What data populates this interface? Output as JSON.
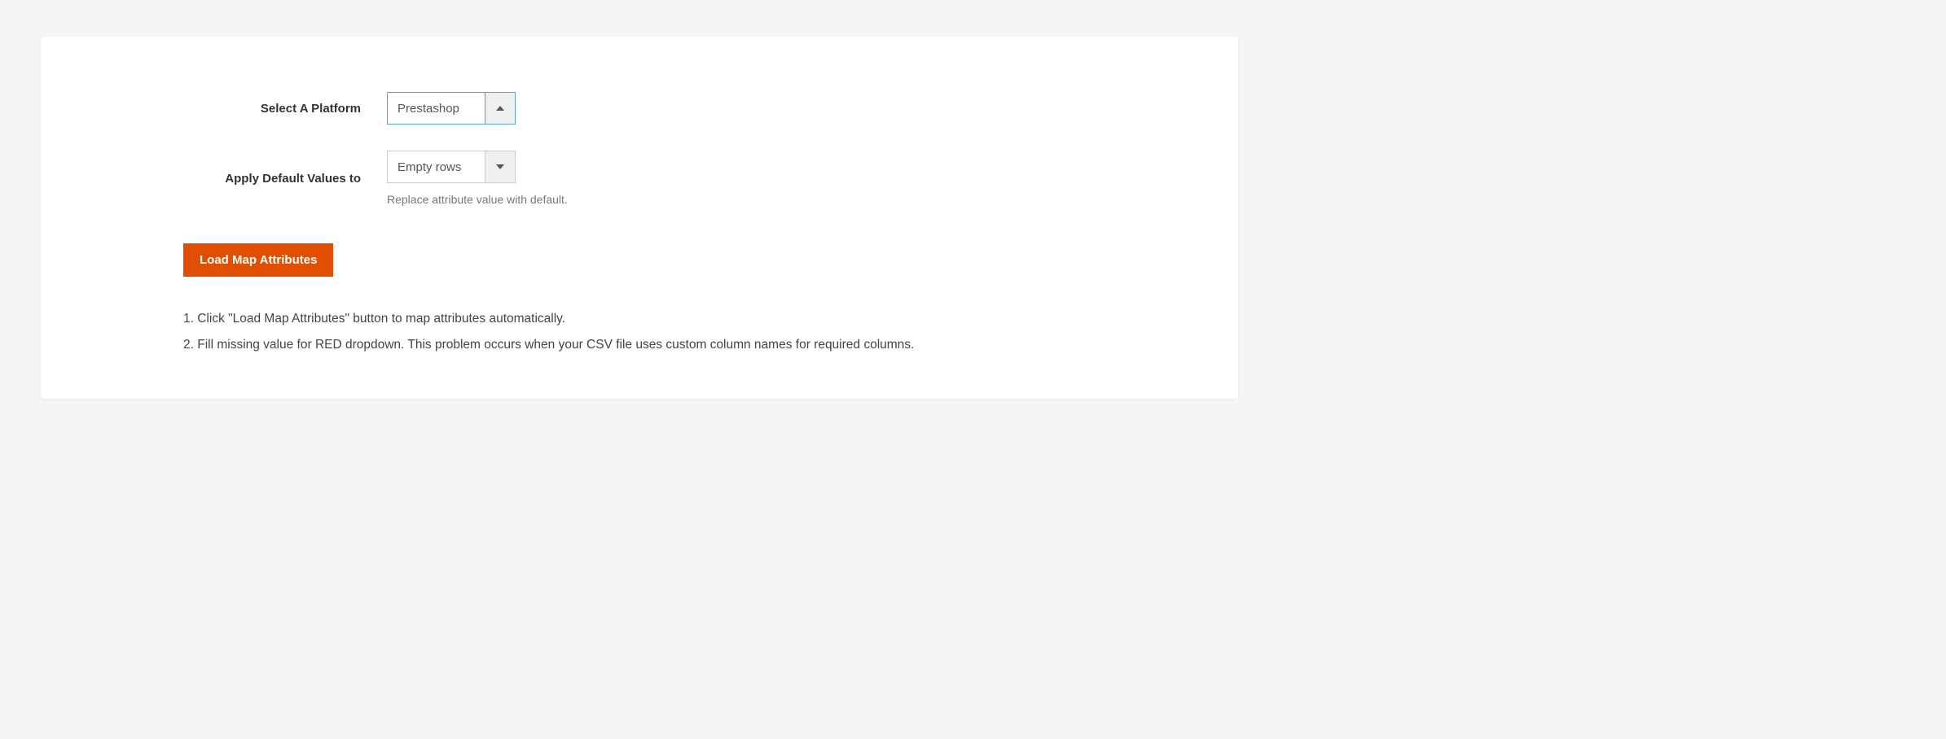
{
  "form": {
    "platform": {
      "label": "Select A Platform",
      "value": "Prestashop"
    },
    "default_values": {
      "label": "Apply Default Values to",
      "value": "Empty rows",
      "help": "Replace attribute value with default."
    }
  },
  "actions": {
    "load_map": "Load Map Attributes"
  },
  "instructions": {
    "step1": "1. Click \"Load Map Attributes\" button to map attributes automatically.",
    "step2": "2. Fill missing value for RED dropdown. This problem occurs when your CSV file uses custom column names for required columns."
  }
}
